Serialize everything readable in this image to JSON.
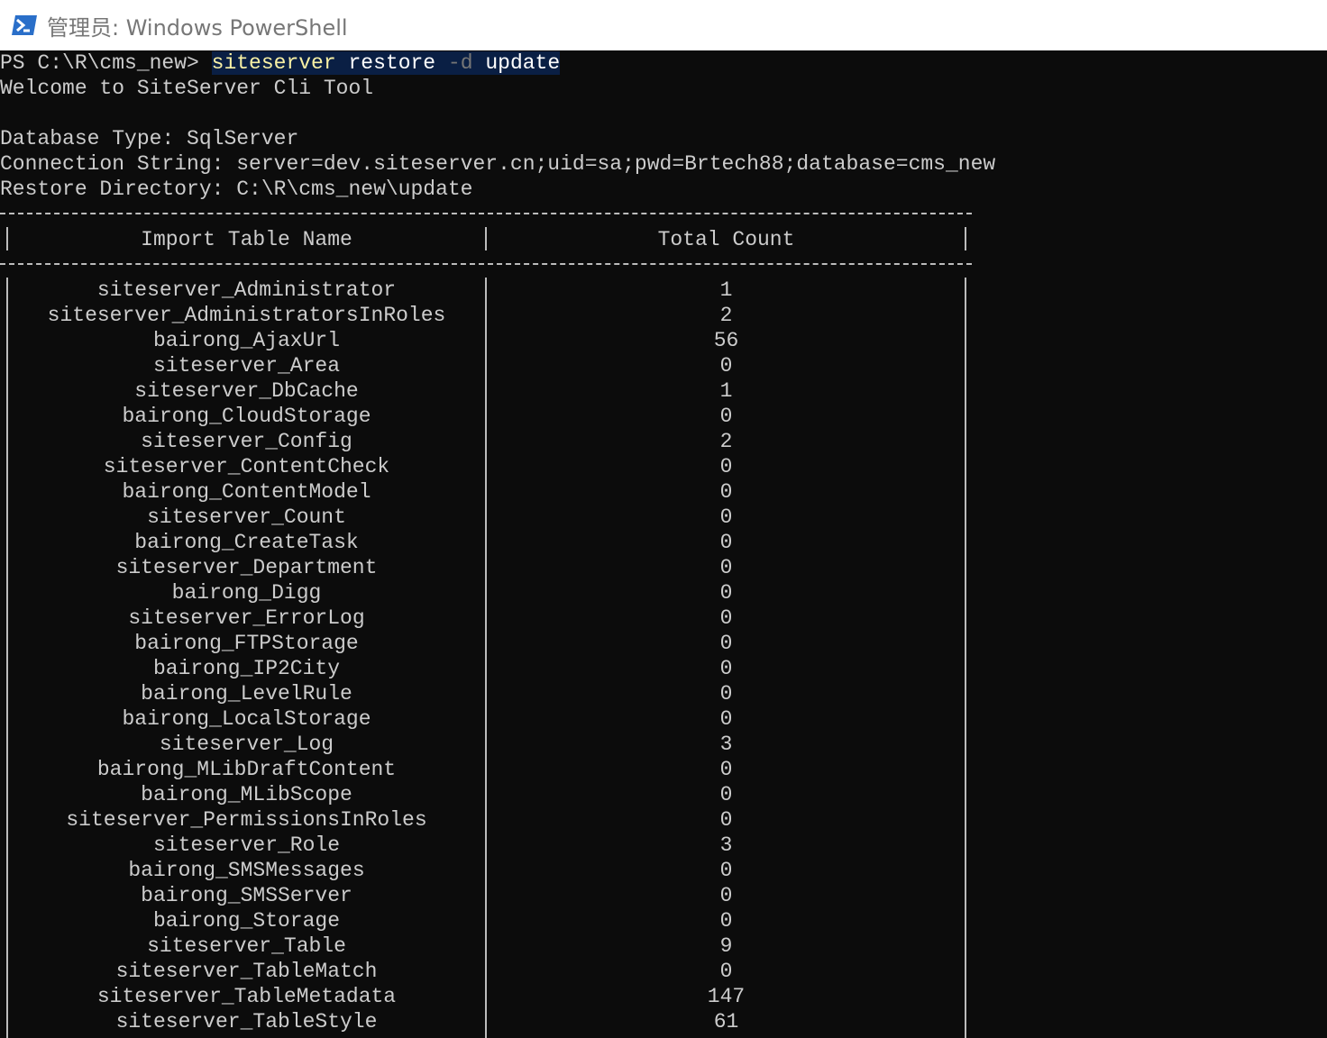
{
  "window": {
    "title": "管理员: Windows PowerShell",
    "icon": "powershell-icon"
  },
  "console": {
    "prompt": "PS C:\\R\\cms_new> ",
    "command": {
      "cmd": "siteserver",
      "arg1": "restore",
      "flag": "-d",
      "arg2": "update"
    },
    "lines": {
      "welcome": "Welcome to SiteServer Cli Tool",
      "db_type": "Database Type: SqlServer",
      "connection": "Connection String: server=dev.siteserver.cn;uid=sa;pwd=Brtech88;database=cms_new",
      "restore_dir": "Restore Directory: C:\\R\\cms_new\\update"
    }
  },
  "table": {
    "headers": [
      "Import Table Name",
      "Total Count"
    ],
    "rows": [
      [
        "siteserver_Administrator",
        "1"
      ],
      [
        "siteserver_AdministratorsInRoles",
        "2"
      ],
      [
        "bairong_AjaxUrl",
        "56"
      ],
      [
        "siteserver_Area",
        "0"
      ],
      [
        "siteserver_DbCache",
        "1"
      ],
      [
        "bairong_CloudStorage",
        "0"
      ],
      [
        "siteserver_Config",
        "2"
      ],
      [
        "siteserver_ContentCheck",
        "0"
      ],
      [
        "bairong_ContentModel",
        "0"
      ],
      [
        "siteserver_Count",
        "0"
      ],
      [
        "bairong_CreateTask",
        "0"
      ],
      [
        "siteserver_Department",
        "0"
      ],
      [
        "bairong_Digg",
        "0"
      ],
      [
        "siteserver_ErrorLog",
        "0"
      ],
      [
        "bairong_FTPStorage",
        "0"
      ],
      [
        "bairong_IP2City",
        "0"
      ],
      [
        "bairong_LevelRule",
        "0"
      ],
      [
        "bairong_LocalStorage",
        "0"
      ],
      [
        "siteserver_Log",
        "3"
      ],
      [
        "bairong_MLibDraftContent",
        "0"
      ],
      [
        "bairong_MLibScope",
        "0"
      ],
      [
        "siteserver_PermissionsInRoles",
        "0"
      ],
      [
        "siteserver_Role",
        "3"
      ],
      [
        "bairong_SMSMessages",
        "0"
      ],
      [
        "bairong_SMSServer",
        "0"
      ],
      [
        "bairong_Storage",
        "0"
      ],
      [
        "siteserver_Table",
        "9"
      ],
      [
        "siteserver_TableMatch",
        "0"
      ],
      [
        "siteserver_TableMetadata",
        "147"
      ],
      [
        "siteserver_TableStyle",
        "61"
      ]
    ]
  }
}
